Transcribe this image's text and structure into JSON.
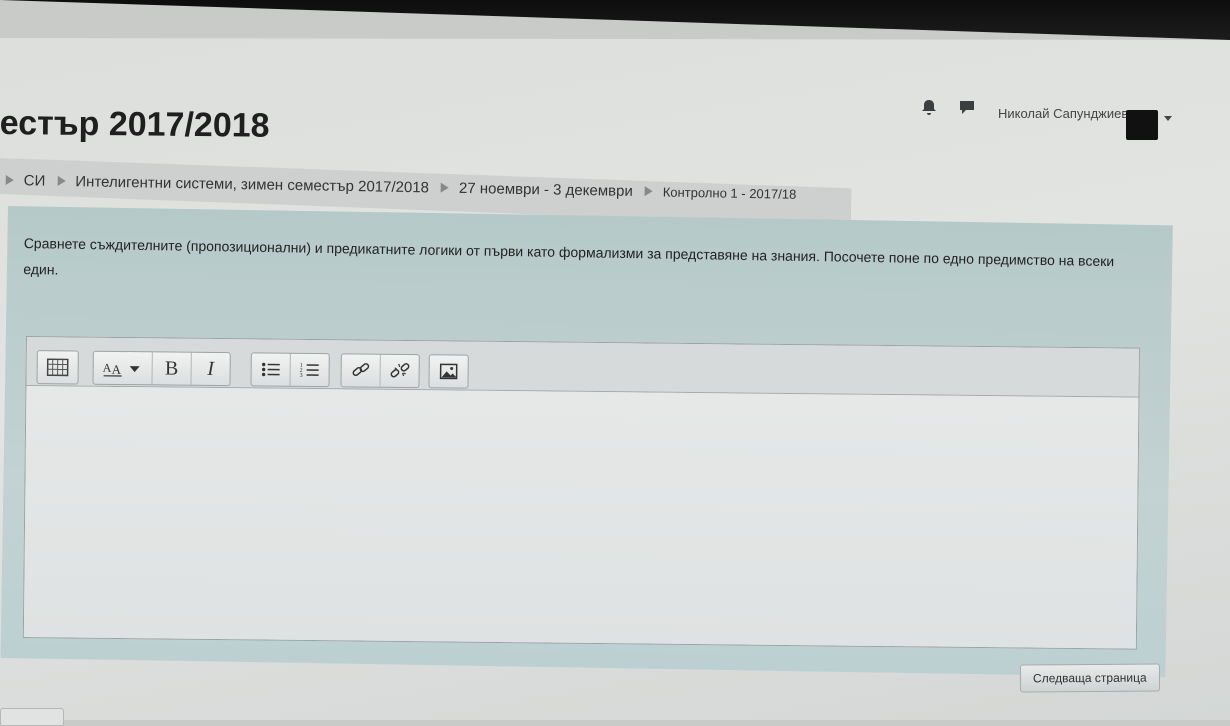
{
  "navbar": {
    "notifications_icon": "bell-icon",
    "messages_icon": "chat-bubble-icon",
    "user_name": "Николай Сапунджиев",
    "user_menu_icon": "caret-down-icon"
  },
  "page": {
    "title": "естър 2017/2018"
  },
  "breadcrumb": {
    "items": [
      {
        "label": "СИ"
      },
      {
        "label": "Интелигентни системи, зимен семестър 2017/2018"
      },
      {
        "label": "27 ноември - 3 декември"
      },
      {
        "label": "Контролно 1 - 2017/18"
      }
    ]
  },
  "question": {
    "text": "Сравнете съждителните (пропозиционални) и предикатните логики от първи като формализми за представяне на знания. Посочете поне по едно предимство на всеки един."
  },
  "editor": {
    "toolbar": [
      {
        "group": [
          "show-more-icon"
        ]
      },
      {
        "group": [
          "font-style-icon",
          "bold-icon",
          "italic-icon"
        ]
      },
      {
        "group": [
          "unordered-list-icon",
          "ordered-list-icon"
        ]
      },
      {
        "group": [
          "link-icon",
          "unlink-icon"
        ]
      },
      {
        "group": [
          "image-icon"
        ]
      }
    ],
    "bold_glyph": "B",
    "italic_glyph": "I",
    "content": ""
  },
  "actions": {
    "next_page": "Следваща страница"
  }
}
